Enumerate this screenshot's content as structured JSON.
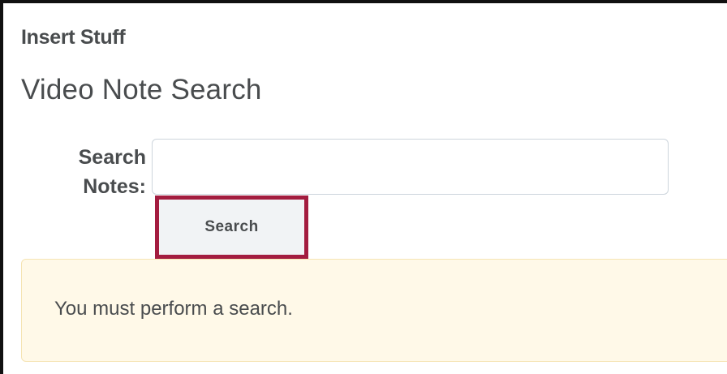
{
  "dialog": {
    "title": "Insert Stuff"
  },
  "page": {
    "title": "Video Note Search"
  },
  "search_form": {
    "label_line1": "Search",
    "label_line2": "Notes:",
    "input_value": "",
    "input_placeholder": "",
    "button_label": "Search"
  },
  "alert": {
    "message": "You must perform a search."
  },
  "colors": {
    "highlight": "#a31c3f",
    "alert_background": "#fff9e8",
    "button_background": "#f1f3f5",
    "text": "#494c4e"
  }
}
